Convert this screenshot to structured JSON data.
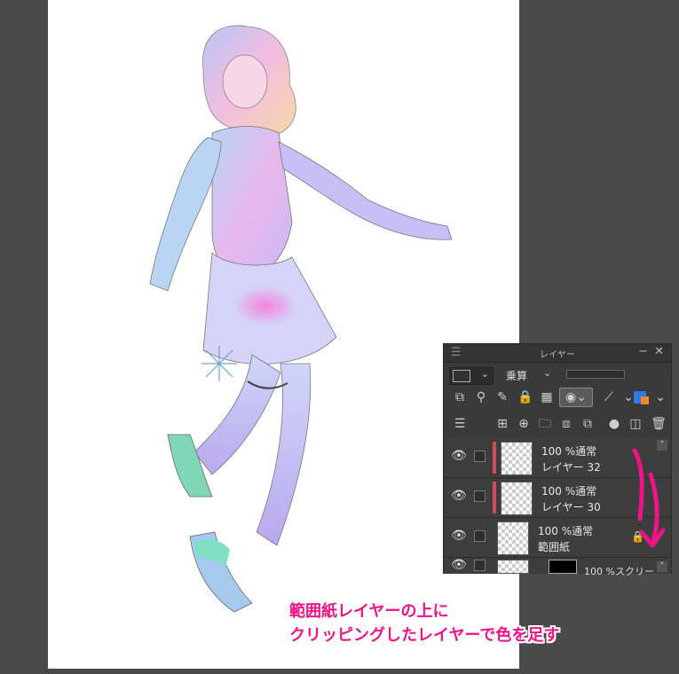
{
  "panel": {
    "title": "レイヤー",
    "blend_mode": "乗算",
    "layers": [
      {
        "opacity_mode": "100 %通常",
        "name": "レイヤー 32",
        "clipped": true
      },
      {
        "opacity_mode": "100 %通常",
        "name": "レイヤー 30",
        "clipped": true
      },
      {
        "opacity_mode": "100 %通常",
        "name": "範囲紙",
        "clipped": false
      },
      {
        "opacity_mode": "100 %スクリー",
        "name": "",
        "clipped": false
      }
    ],
    "icons": {
      "menu": "hamburger-icon",
      "collapse": "minimize-icon",
      "close": "close-icon"
    }
  },
  "caption": {
    "line1": "範囲紙レイヤーの上に",
    "line2": "クリッピングしたレイヤーで色を足す"
  },
  "colors": {
    "accent": "#ec1487",
    "clip_bar": "#d04a5c",
    "panel_bg": "#3a3a3a",
    "workspace_bg": "#4a4a4a"
  }
}
